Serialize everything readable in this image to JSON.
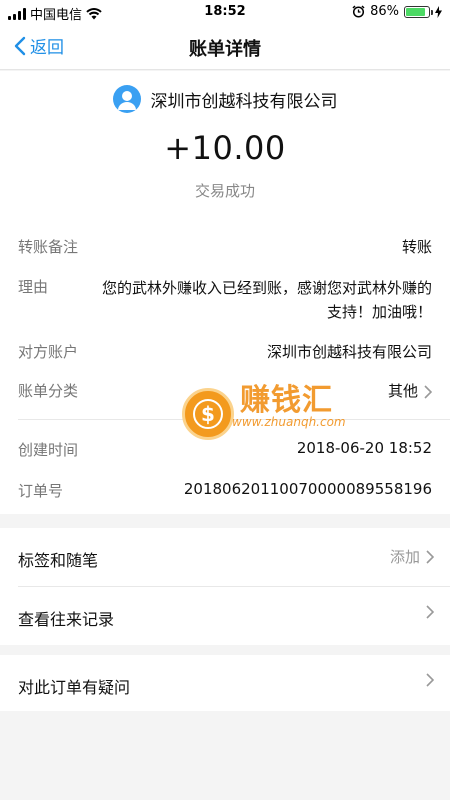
{
  "status_bar": {
    "carrier": "中国电信",
    "time": "18:52",
    "battery": "86%",
    "battery_level": 0.86
  },
  "nav": {
    "back_label": "返回",
    "title": "账单详情"
  },
  "summary": {
    "merchant": "深圳市创越科技有限公司",
    "amount": "+10.00",
    "status": "交易成功"
  },
  "details": {
    "remark_label": "转账备注",
    "remark_value": "转账",
    "reason_label": "理由",
    "reason_value": "您的武林外赚收入已经到账，感谢您对武林外赚的支持！加油哦！",
    "account_label": "对方账户",
    "account_value": "深圳市创越科技有限公司",
    "category_label": "账单分类",
    "category_value": "其他",
    "created_label": "创建时间",
    "created_value": "2018-06-20 18:52",
    "order_label": "订单号",
    "order_value": "20180620110070000089558196"
  },
  "list": {
    "tags_label": "标签和随笔",
    "tags_action": "添加",
    "history_label": "查看往来记录",
    "question_label": "对此订单有疑问"
  },
  "watermark": {
    "text": "赚钱汇",
    "url": "www.zhuanqh.com",
    "symbol": "$"
  },
  "colors": {
    "accent": "#1f8fe6",
    "avatar": "#3aa0f2",
    "battery": "#4cd964",
    "watermark": "#f08a0c"
  }
}
